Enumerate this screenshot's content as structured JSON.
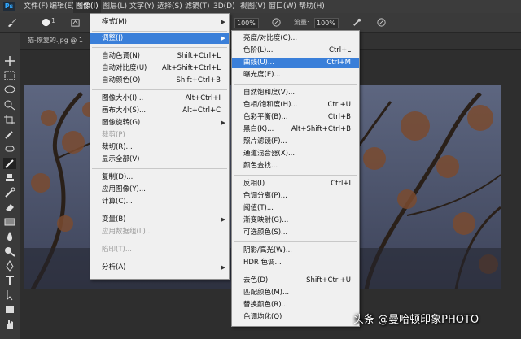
{
  "menubar": {
    "items": [
      "文件(F)",
      "编辑(E)",
      "图像(I)",
      "图层(L)",
      "文字(Y)",
      "选择(S)",
      "滤镜(T)",
      "3D(D)",
      "视图(V)",
      "窗口(W)",
      "帮助(H)"
    ]
  },
  "options": {
    "opacity_value": "100%",
    "flow_label": "流量:",
    "flow_value": "100%",
    "brush_size": "1"
  },
  "document": {
    "tab_title": "猫-恢复的.jpg @ 1"
  },
  "image_menu": {
    "items": [
      {
        "label": "模式(M)",
        "shortcut": ""
      },
      {
        "label": "调整(J)",
        "shortcut": ""
      },
      {
        "label": "自动色调(N)",
        "shortcut": "Shift+Ctrl+L"
      },
      {
        "label": "自动对比度(U)",
        "shortcut": "Alt+Shift+Ctrl+L"
      },
      {
        "label": "自动颜色(O)",
        "shortcut": "Shift+Ctrl+B"
      },
      {
        "label": "图像大小(I)...",
        "shortcut": "Alt+Ctrl+I"
      },
      {
        "label": "画布大小(S)...",
        "shortcut": "Alt+Ctrl+C"
      },
      {
        "label": "图像旋转(G)",
        "shortcut": ""
      },
      {
        "label": "裁剪(P)",
        "shortcut": ""
      },
      {
        "label": "裁切(R)...",
        "shortcut": ""
      },
      {
        "label": "显示全部(V)",
        "shortcut": ""
      },
      {
        "label": "复制(D)...",
        "shortcut": ""
      },
      {
        "label": "应用图像(Y)...",
        "shortcut": ""
      },
      {
        "label": "计算(C)...",
        "shortcut": ""
      },
      {
        "label": "变量(B)",
        "shortcut": ""
      },
      {
        "label": "应用数据组(L)...",
        "shortcut": ""
      },
      {
        "label": "陷印(T)...",
        "shortcut": ""
      },
      {
        "label": "分析(A)",
        "shortcut": ""
      }
    ]
  },
  "adjust_menu": {
    "items": [
      {
        "label": "亮度/对比度(C)...",
        "shortcut": ""
      },
      {
        "label": "色阶(L)...",
        "shortcut": "Ctrl+L"
      },
      {
        "label": "曲线(U)...",
        "shortcut": "Ctrl+M"
      },
      {
        "label": "曝光度(E)...",
        "shortcut": ""
      },
      {
        "label": "自然饱和度(V)...",
        "shortcut": ""
      },
      {
        "label": "色相/饱和度(H)...",
        "shortcut": "Ctrl+U"
      },
      {
        "label": "色彩平衡(B)...",
        "shortcut": "Ctrl+B"
      },
      {
        "label": "黑白(K)...",
        "shortcut": "Alt+Shift+Ctrl+B"
      },
      {
        "label": "照片滤镜(F)...",
        "shortcut": ""
      },
      {
        "label": "通道混合器(X)...",
        "shortcut": ""
      },
      {
        "label": "颜色查找...",
        "shortcut": ""
      },
      {
        "label": "反相(I)",
        "shortcut": "Ctrl+I"
      },
      {
        "label": "色调分离(P)...",
        "shortcut": ""
      },
      {
        "label": "阈值(T)...",
        "shortcut": ""
      },
      {
        "label": "渐变映射(G)...",
        "shortcut": ""
      },
      {
        "label": "可选颜色(S)...",
        "shortcut": ""
      },
      {
        "label": "阴影/高光(W)...",
        "shortcut": ""
      },
      {
        "label": "HDR 色调...",
        "shortcut": ""
      },
      {
        "label": "去色(D)",
        "shortcut": "Shift+Ctrl+U"
      },
      {
        "label": "匹配颜色(M)...",
        "shortcut": ""
      },
      {
        "label": "替换颜色(R)...",
        "shortcut": ""
      },
      {
        "label": "色调均化(Q)",
        "shortcut": ""
      }
    ]
  },
  "watermark": "头条 @曼哈顿印象PHOTO",
  "colors": {
    "menu_bg": "#f0f0f0",
    "highlight": "#3a7fd9",
    "ui_dark": "#3a3a3a"
  }
}
